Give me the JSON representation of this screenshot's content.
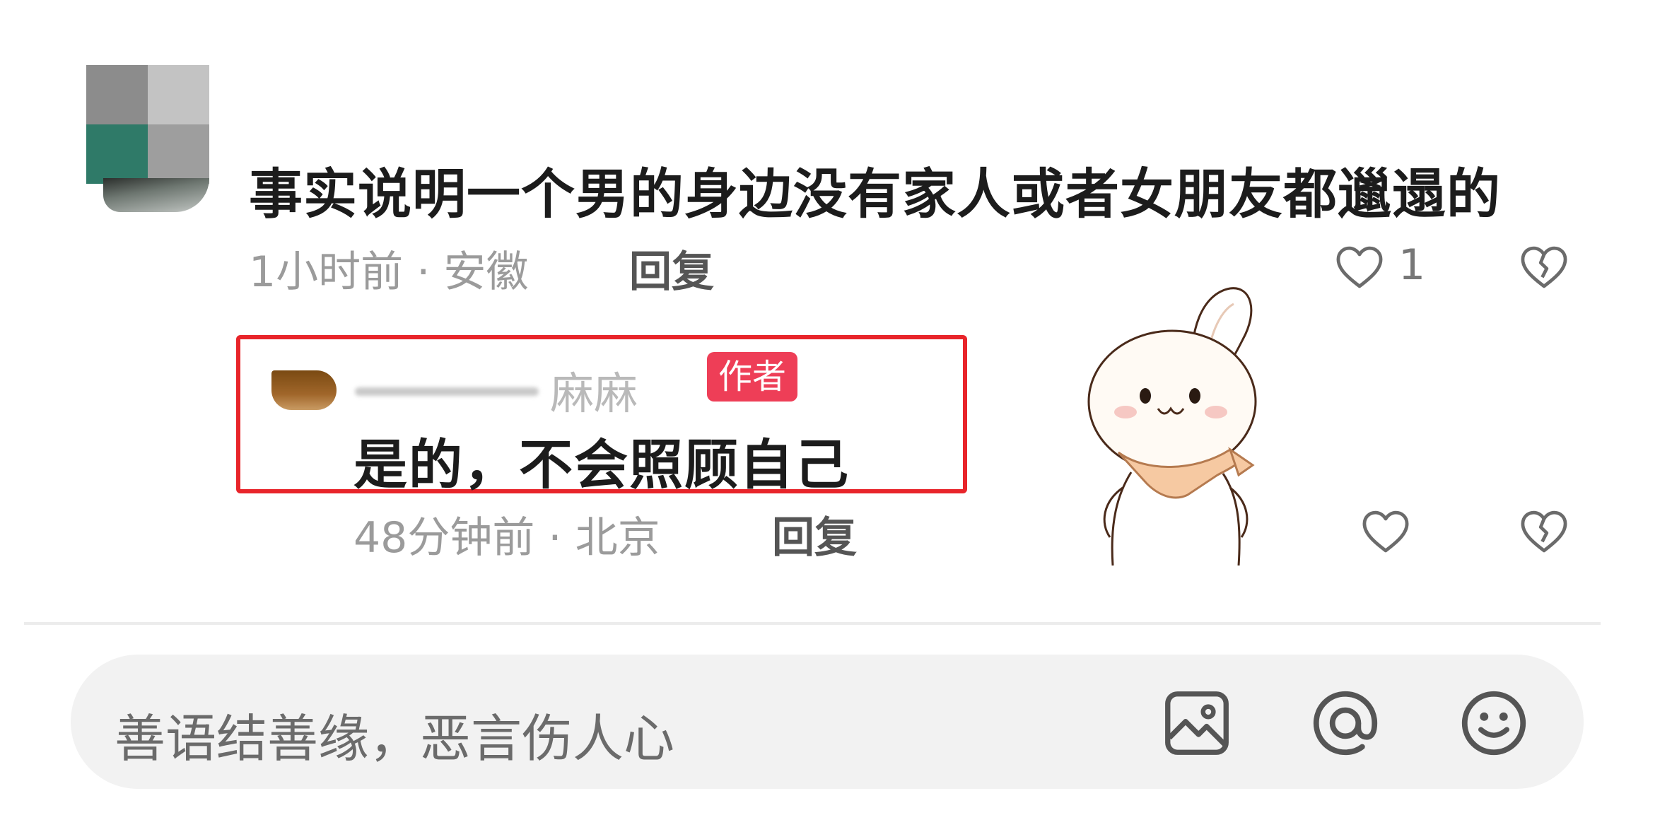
{
  "comment": {
    "text": "事实说明一个男的身边没有家人或者女朋友都邋遢的",
    "time_location": "1小时前 · 安徽",
    "reply_label": "回复",
    "like_count": "1"
  },
  "reply": {
    "username": "麻麻",
    "badge": "作者",
    "text": "是的，不会照顾自己",
    "time_location": "48分钟前 · 北京",
    "reply_label": "回复"
  },
  "input": {
    "placeholder": "善语结善缘，恶言伤人心"
  },
  "icons": {
    "like": "heart-icon",
    "dislike": "broken-heart-icon",
    "image": "image-icon",
    "mention": "at-icon",
    "emoji": "smiley-icon",
    "sticker": "rabbit-sticker"
  },
  "colors": {
    "highlight_border": "#e8242a",
    "author_badge": "#ee3e57"
  }
}
